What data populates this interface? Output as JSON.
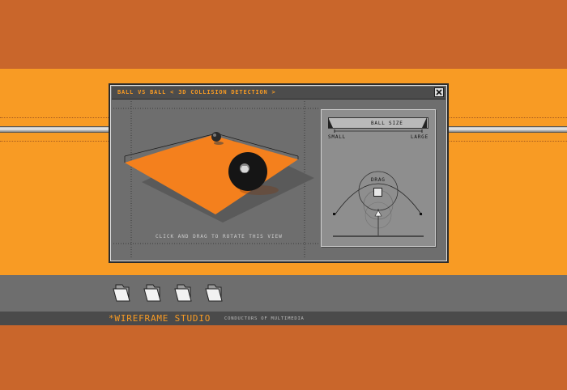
{
  "window": {
    "title": "BALL VS BALL < 3D COLLISION DETECTION >",
    "close_icon": "close-icon"
  },
  "viewport": {
    "hint": "CLICK AND DRAG TO ROTATE THIS VIEW"
  },
  "controls": {
    "ball_size_label": "BALL SIZE",
    "small_label": "SMALL",
    "large_label": "LARGE",
    "drag_label": "DRAG"
  },
  "dock": {
    "items": [
      {
        "icon": "folder-icon"
      },
      {
        "icon": "folder-icon"
      },
      {
        "icon": "folder-icon"
      },
      {
        "icon": "folder-icon"
      }
    ]
  },
  "footer": {
    "brand": "*WIREFRAME STUDIO",
    "tagline": "CONDUCTORS OF MULTIMEDIA"
  },
  "colors": {
    "orange": "#F89B24",
    "rust": "#C9662B",
    "window_gray": "#6E6E6E",
    "footer_dark": "#4A4A4A"
  }
}
